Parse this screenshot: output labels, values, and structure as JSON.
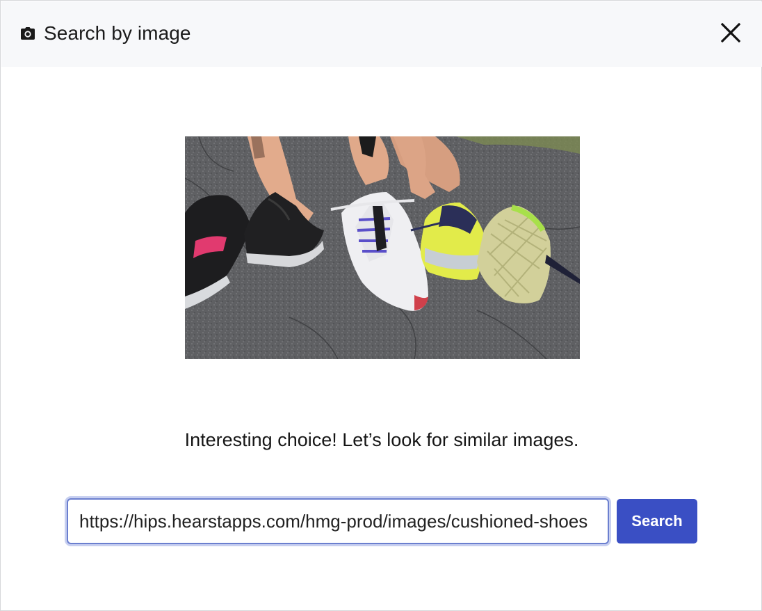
{
  "dialog": {
    "title": "Search by image",
    "icon": "camera-icon",
    "close_icon": "close-icon"
  },
  "preview": {
    "description_icon": "image-preview"
  },
  "message": "Interesting choice! Let’s look for similar images.",
  "search": {
    "url_value": "https://hips.hearstapps.com/hmg-prod/images/cushioned-shoes",
    "button_label": "Search"
  },
  "colors": {
    "header_bg": "#f7f8fa",
    "accent": "#3a4fc4",
    "input_border": "#6b7fcf"
  }
}
